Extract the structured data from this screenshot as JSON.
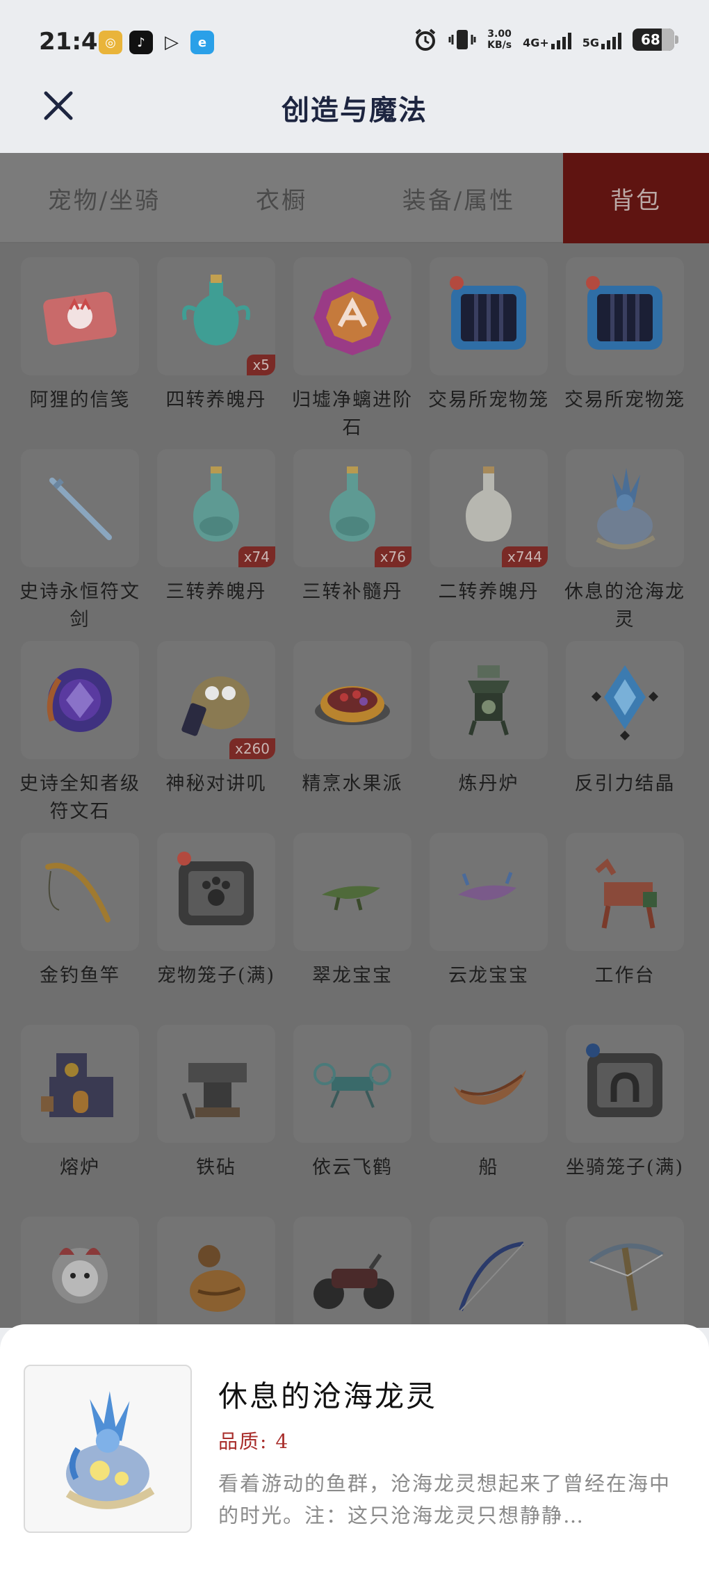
{
  "status": {
    "time": "21:45",
    "speed_value": "3.00",
    "speed_unit": "KB/s",
    "net1": "4G+",
    "net2": "5G",
    "battery": "68"
  },
  "header": {
    "title": "创造与魔法"
  },
  "tabs": [
    {
      "label": "宠物/坐骑",
      "active": false
    },
    {
      "label": "衣橱",
      "active": false
    },
    {
      "label": "装备/属性",
      "active": false
    },
    {
      "label": "背包",
      "active": true
    }
  ],
  "items": [
    {
      "name": "阿狸的信笺",
      "icon": "letter-icon"
    },
    {
      "name": "四转养魄丹",
      "icon": "potion-vase-icon",
      "count": "x5"
    },
    {
      "name": "归墟净螭进阶石",
      "icon": "gem-icon"
    },
    {
      "name": "交易所宠物笼",
      "icon": "pet-cage-blue-icon"
    },
    {
      "name": "交易所宠物笼",
      "icon": "pet-cage-blue-icon"
    },
    {
      "name": "史诗永恒符文剑",
      "icon": "sword-icon"
    },
    {
      "name": "三转养魄丹",
      "icon": "potion-bottle-icon",
      "count": "x74"
    },
    {
      "name": "三转补髓丹",
      "icon": "potion-bottle-icon",
      "count": "x76"
    },
    {
      "name": "二转养魄丹",
      "icon": "white-bottle-icon",
      "count": "x744"
    },
    {
      "name": "休息的沧海龙灵",
      "icon": "dragon-spirit-icon"
    },
    {
      "name": "史诗全知者级符文石",
      "icon": "rune-stone-icon"
    },
    {
      "name": "神秘对讲叽",
      "icon": "walkie-talkie-icon",
      "count": "x260"
    },
    {
      "name": "精烹水果派",
      "icon": "fruit-pie-icon"
    },
    {
      "name": "炼丹炉",
      "icon": "furnace-icon"
    },
    {
      "name": "反引力结晶",
      "icon": "crystal-icon"
    },
    {
      "name": "金钓鱼竿",
      "icon": "fishing-rod-icon"
    },
    {
      "name": "宠物笼子(满)",
      "icon": "pet-cage-full-icon"
    },
    {
      "name": "翠龙宝宝",
      "icon": "green-dragon-icon"
    },
    {
      "name": "云龙宝宝",
      "icon": "cloud-dragon-icon"
    },
    {
      "name": "工作台",
      "icon": "workbench-icon"
    },
    {
      "name": "熔炉",
      "icon": "smelter-icon"
    },
    {
      "name": "铁砧",
      "icon": "anvil-icon"
    },
    {
      "name": "依云飞鹤",
      "icon": "crane-drone-icon"
    },
    {
      "name": "船",
      "icon": "boat-icon"
    },
    {
      "name": "坐骑笼子(满)",
      "icon": "mount-cage-full-icon"
    },
    {
      "name": "",
      "icon": "lion-doll-icon"
    },
    {
      "name": "",
      "icon": "gourd-icon"
    },
    {
      "name": "",
      "icon": "motorcycle-icon"
    },
    {
      "name": "",
      "icon": "bow-icon"
    },
    {
      "name": "",
      "icon": "crossbow-icon"
    }
  ],
  "detail": {
    "title": "休息的沧海龙灵",
    "quality_label": "品质:",
    "quality_value": "4",
    "description": "看着游动的鱼群，沧海龙灵想起来了曾经在海中的时光。注：这只沧海龙灵只想静静…"
  }
}
